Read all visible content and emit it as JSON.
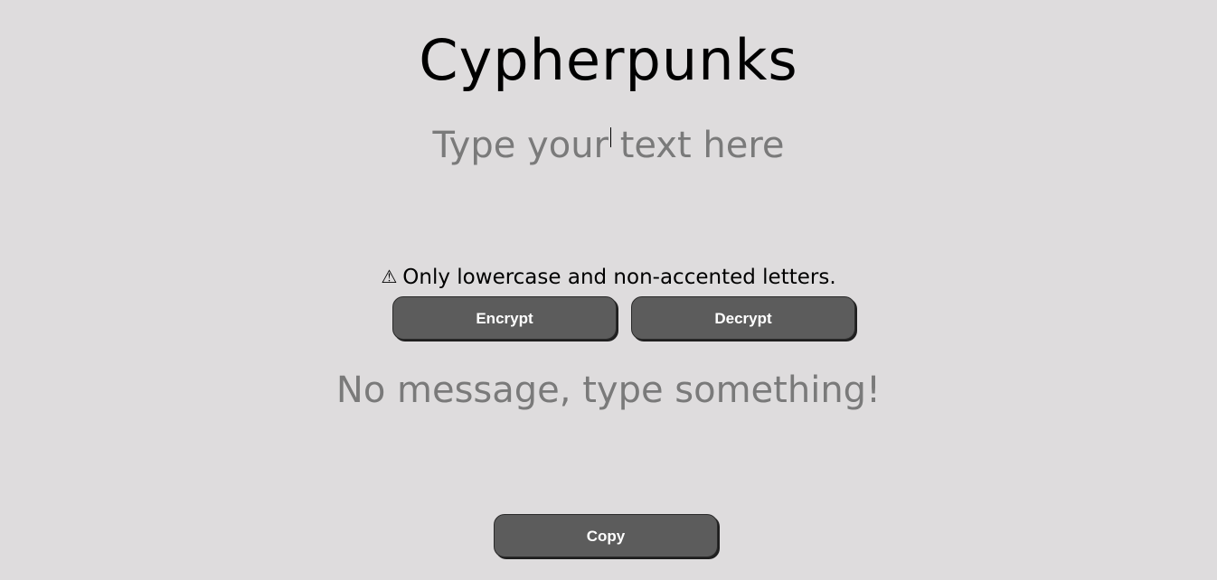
{
  "header": {
    "title": "Cypherpunks"
  },
  "input": {
    "placeholder": "Type your text here",
    "value": ""
  },
  "notice": {
    "icon": "warning-icon",
    "icon_glyph": "⚠",
    "text": "Only lowercase and non-accented letters."
  },
  "actions": {
    "encrypt_label": "Encrypt",
    "decrypt_label": "Decrypt",
    "copy_label": "Copy"
  },
  "output": {
    "message": "No message, type something!"
  },
  "colors": {
    "background": "#dedcdd",
    "button": "#5c5c5c",
    "button_text": "#ffffff",
    "muted_text": "#7a7a7a"
  }
}
